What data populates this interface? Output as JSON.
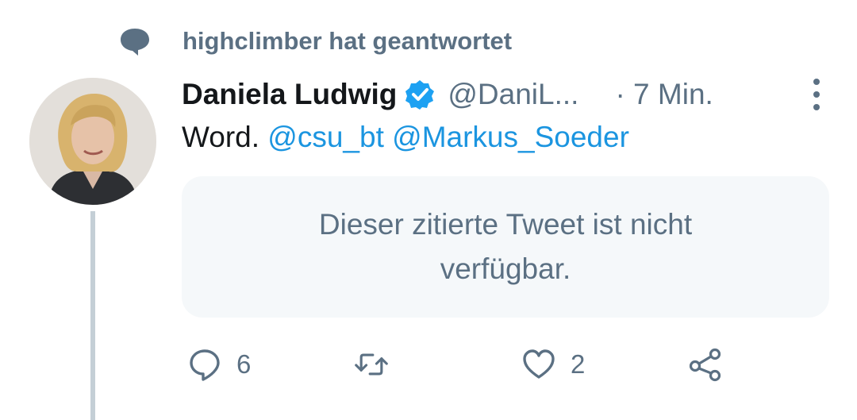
{
  "context": {
    "text": "highclimber hat geantwortet",
    "icon": "speech-bubble-icon"
  },
  "tweet": {
    "author_name": "Daniela Ludwig",
    "handle": "@DaniL...",
    "time": "· 7 Min.",
    "text_plain": "Word.",
    "mention_1": "@csu_bt",
    "mention_2": "@Markus_Soeder",
    "quote_unavailable": "Dieser zitierte Tweet ist nicht verfügbar."
  },
  "actions": {
    "reply_count": "6",
    "like_count": "2"
  },
  "colors": {
    "muted": "#5b7083",
    "text": "#14171a",
    "link": "#1b95e0",
    "verified": "#1da1f2",
    "thread_line": "#c4cfd6",
    "quote_bg": "#f5f8fa"
  }
}
